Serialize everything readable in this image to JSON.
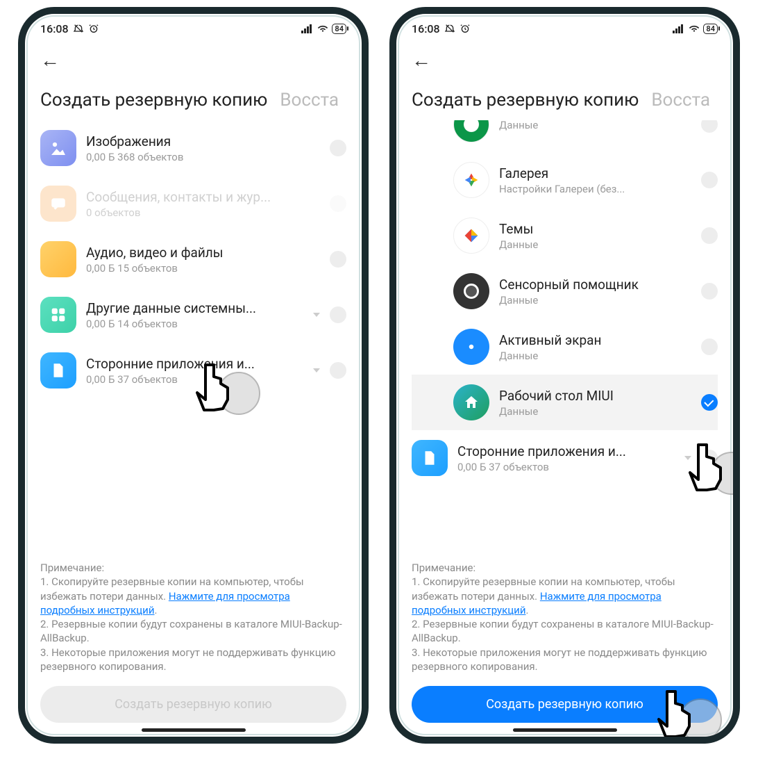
{
  "status": {
    "time": "16:08",
    "battery": "84"
  },
  "tabs": {
    "active": "Создать резервную копию",
    "inactive": "Восста"
  },
  "left_rows": [
    {
      "id": "images",
      "title": "Изображения",
      "sub": "0,00 Б  368 объектов"
    },
    {
      "id": "messages",
      "title": "Сообщения, контакты и жур...",
      "sub": "0 объектов",
      "disabled": true
    },
    {
      "id": "audio",
      "title": "Аудио, видео и файлы",
      "sub": "0,00 Б  15 объектов"
    },
    {
      "id": "system",
      "title": "Другие данные системны...",
      "sub": "0,00 Б  14 объектов",
      "chev": true
    },
    {
      "id": "third",
      "title": "Сторонние приложения и...",
      "sub": "0,00 Б  37 объектов",
      "chev": true
    }
  ],
  "right_rows": [
    {
      "id": "green",
      "title": "",
      "sub": "Данные",
      "partial": true
    },
    {
      "id": "gallery",
      "title": "Галерея",
      "sub": "Настройки Галереи (без..."
    },
    {
      "id": "themes",
      "title": "Темы",
      "sub": "Данные"
    },
    {
      "id": "sensor",
      "title": "Сенсорный помощник",
      "sub": "Данные"
    },
    {
      "id": "active",
      "title": "Активный экран",
      "sub": "Данные"
    },
    {
      "id": "desktop",
      "title": "Рабочий стол MIUI",
      "sub": "Данные",
      "highlighted": true,
      "checked": true
    },
    {
      "id": "third2",
      "title": "Сторонние приложения и...",
      "sub": "0,00 Б  37 объектов",
      "square": true,
      "chev": true
    }
  ],
  "notes": {
    "heading": "Примечание:",
    "l1a": "1. Скопируйте резервные копии на компьютер, чтобы избежать потери данных. ",
    "link": "Нажмите для просмотра подробных инструкций",
    "l2": "2. Резервные копии будут сохранены в каталоге MIUI-Backup-AllBackup.",
    "l3": "3. Некоторые приложения могут не поддерживать функцию резервного копирования."
  },
  "button": "Создать резервную копию"
}
